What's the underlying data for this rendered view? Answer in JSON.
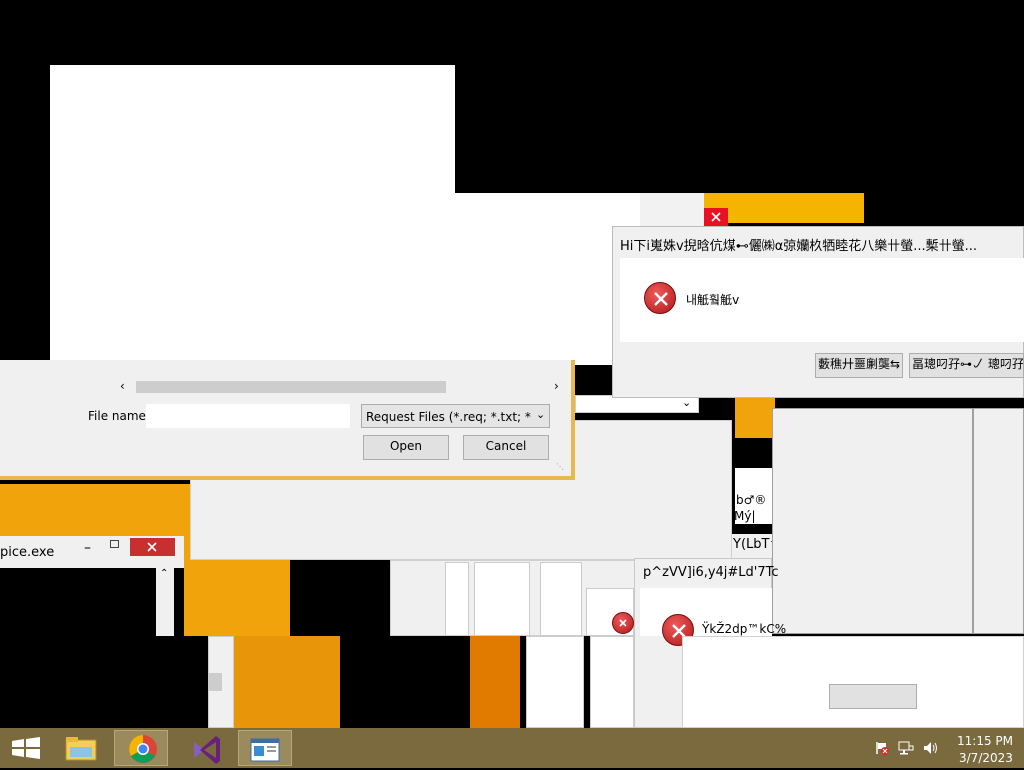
{
  "file_dialog": {
    "filename_label": "File name:",
    "filename_value": "",
    "filter_value": "Request Files (*.req; *.txt; *.cmc",
    "open_label": "Open",
    "cancel_label": "Cancel"
  },
  "small_window": {
    "title": "pice.exe"
  },
  "error_dialog_top": {
    "title": "Hi下i嵬姝v掜晗伉煤⊷儷㈱α弶孏杦牺睦花八樂卄螢...槧卄螢...",
    "message": "내觝훸觝v",
    "button1_label": "藪穛廾噩劆龑⇆",
    "button2_label": "畐璁叼孖⊶㇢ 璁叼孖⊶㇢"
  },
  "error_dialog_bottom": {
    "title": "p^zVV]i6,y4j#Ld'7Tc",
    "message": "ŸkŽ2dp™kC%",
    "button_label": ""
  },
  "fragments": {
    "garble1": "b♂®",
    "garble2": "Mý|",
    "garble3": "Y(LbT^"
  },
  "taskbar": {
    "time": "11:15 PM",
    "date": "3/7/2023",
    "apps": [
      "start",
      "file-explorer",
      "chrome",
      "visual-studio",
      "app-window"
    ]
  },
  "colors": {
    "orange": "#f0a30a",
    "deep_orange": "#e07b00",
    "taskbar": "#7a6a3e",
    "dialog_border": "#e6b84f"
  }
}
